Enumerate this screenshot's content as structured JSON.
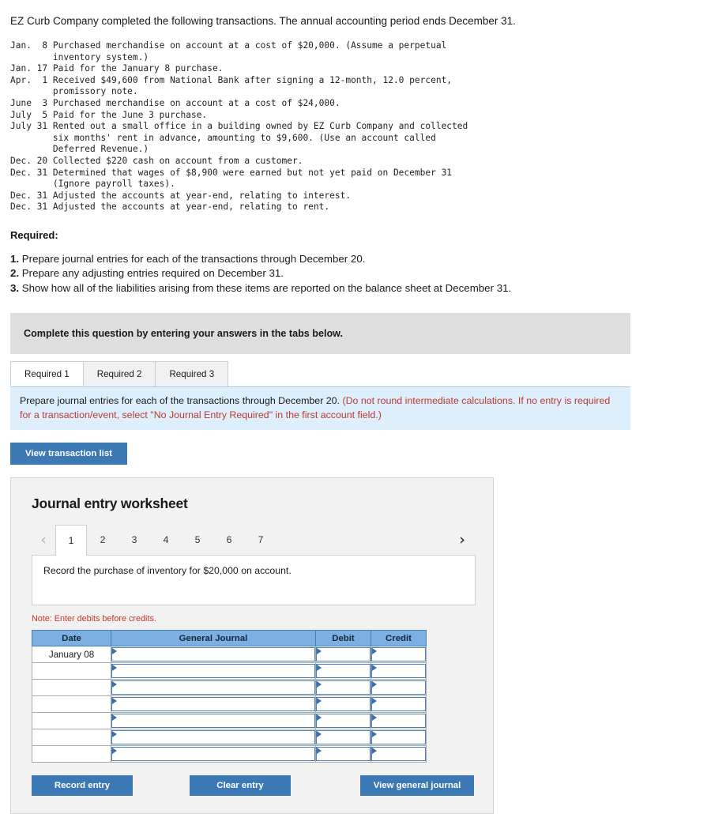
{
  "intro": "EZ Curb Company completed the following transactions. The annual accounting period ends December 31.",
  "transactions_text": "Jan.  8 Purchased merchandise on account at a cost of $20,000. (Assume a perpetual\n        inventory system.)\nJan. 17 Paid for the January 8 purchase.\nApr.  1 Received $49,600 from National Bank after signing a 12-month, 12.0 percent,\n        promissory note.\nJune  3 Purchased merchandise on account at a cost of $24,000.\nJuly  5 Paid for the June 3 purchase.\nJuly 31 Rented out a small office in a building owned by EZ Curb Company and collected\n        six months' rent in advance, amounting to $9,600. (Use an account called\n        Deferred Revenue.)\nDec. 20 Collected $220 cash on account from a customer.\nDec. 31 Determined that wages of $8,900 were earned but not yet paid on December 31\n        (Ignore payroll taxes).\nDec. 31 Adjusted the accounts at year-end, relating to interest.\nDec. 31 Adjusted the accounts at year-end, relating to rent.",
  "required": {
    "label": "Required:",
    "items": [
      {
        "num": "1.",
        "text": "Prepare journal entries for each of the transactions through December 20."
      },
      {
        "num": "2.",
        "text": "Prepare any adjusting entries required on December 31."
      },
      {
        "num": "3.",
        "text": "Show how all of the liabilities arising from these items are reported on the balance sheet at December 31."
      }
    ]
  },
  "instruction_bar": "Complete this question by entering your answers in the tabs below.",
  "tabs": [
    {
      "label": "Required 1",
      "active": true
    },
    {
      "label": "Required 2",
      "active": false
    },
    {
      "label": "Required 3",
      "active": false
    }
  ],
  "info_banner": {
    "black_text": "Prepare journal entries for each of the transactions through December 20. ",
    "red_text": "(Do not round intermediate calculations. If no entry is required for a transaction/event, select \"No Journal Entry Required\" in the first account field.)"
  },
  "view_transaction_button": "View transaction list",
  "worksheet": {
    "title": "Journal entry worksheet",
    "prev_arrow_glyph": "‹",
    "next_arrow_glyph": "›",
    "pages": [
      "1",
      "2",
      "3",
      "4",
      "5",
      "6",
      "7"
    ],
    "active_page": "1",
    "description": "Record the purchase of inventory for $20,000 on account.",
    "note": "Note: Enter debits before credits.",
    "table": {
      "headers": [
        "Date",
        "General Journal",
        "Debit",
        "Credit"
      ],
      "rows": [
        {
          "date": "January 08",
          "general_journal": "",
          "debit": "",
          "credit": ""
        },
        {
          "date": "",
          "general_journal": "",
          "debit": "",
          "credit": ""
        },
        {
          "date": "",
          "general_journal": "",
          "debit": "",
          "credit": ""
        },
        {
          "date": "",
          "general_journal": "",
          "debit": "",
          "credit": ""
        },
        {
          "date": "",
          "general_journal": "",
          "debit": "",
          "credit": ""
        },
        {
          "date": "",
          "general_journal": "",
          "debit": "",
          "credit": ""
        },
        {
          "date": "",
          "general_journal": "",
          "debit": "",
          "credit": ""
        }
      ]
    },
    "buttons": {
      "record": "Record entry",
      "clear": "Clear entry",
      "view_general_journal": "View general journal"
    }
  },
  "colors": {
    "button_blue": "#3b78b4",
    "table_header_blue": "#7cb0e2",
    "cell_border_blue": "#4a7fb5",
    "info_banner_bg": "#ddeffc",
    "grey_bar_bg": "#dedede",
    "note_red": "#c0392b"
  }
}
